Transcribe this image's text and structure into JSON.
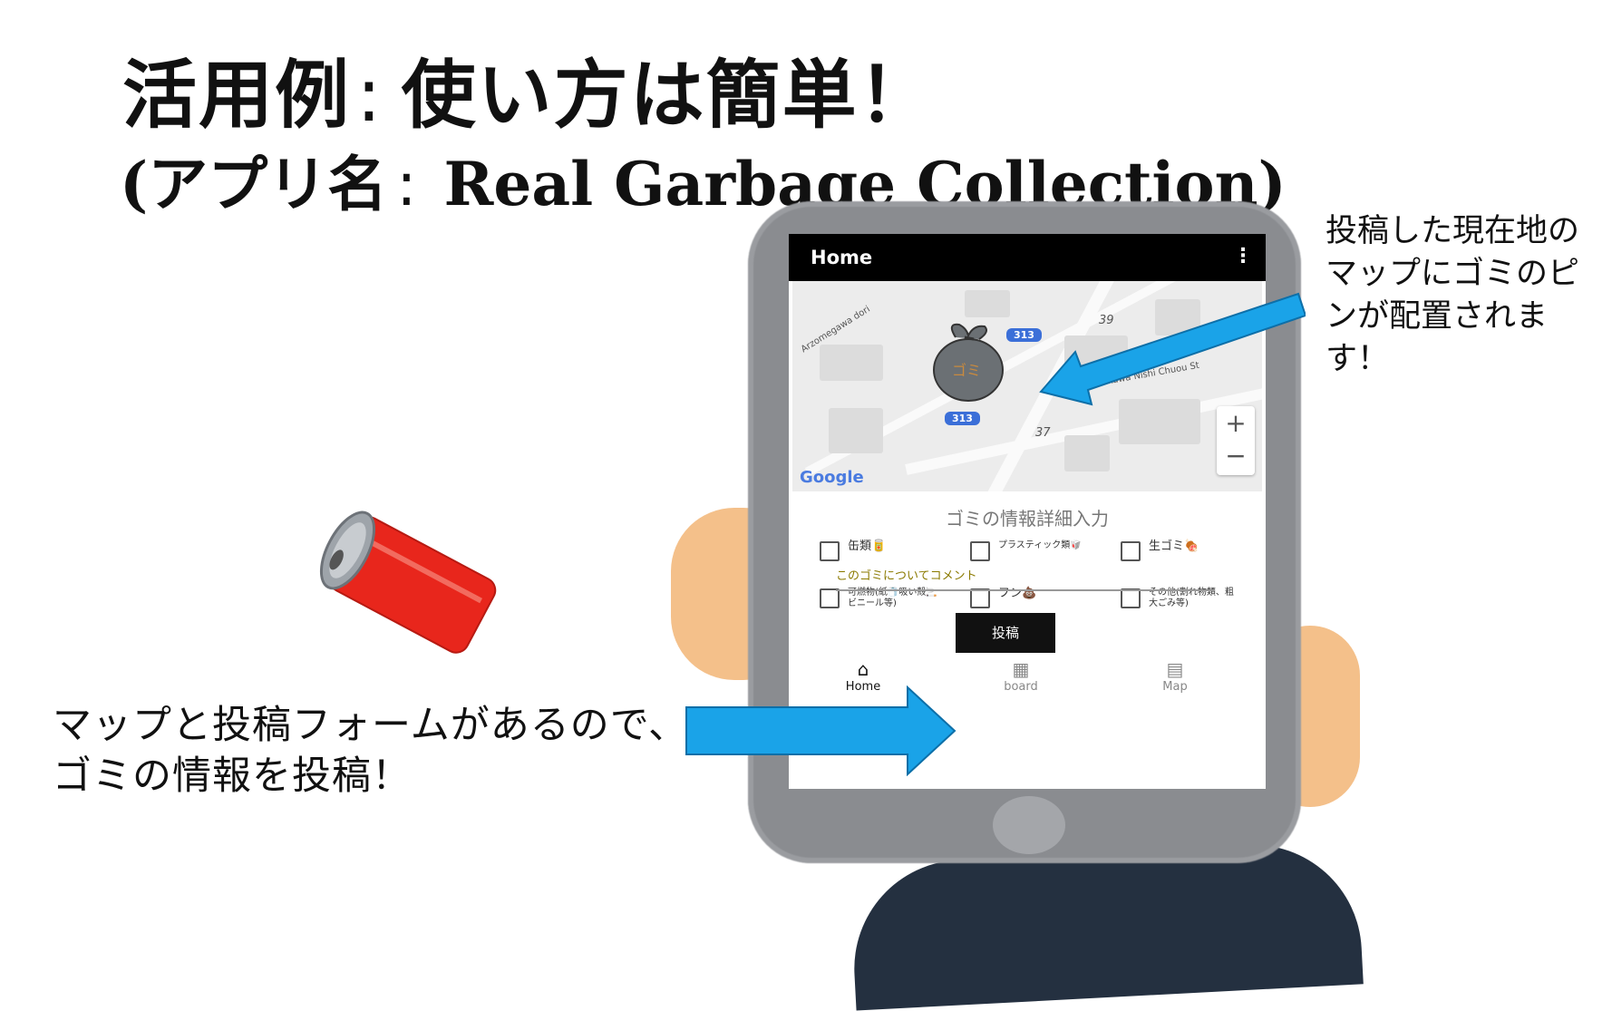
{
  "title": {
    "line1_label": "活用例",
    "line1_sep": ":",
    "line1_text": "使い方は簡単！",
    "line2_open": "(",
    "line2_label": "アプリ名",
    "line2_sep": ":",
    "line2_app": "Real Garbage Collection)"
  },
  "app": {
    "appbar_title": "Home",
    "appbar_menu_icon": "more-vert-icon",
    "map": {
      "road_labels": [
        "Arzomegawa dori",
        "Arakawa Nishi Chuou St"
      ],
      "route_shields": [
        "313",
        "313"
      ],
      "numbers": [
        "39",
        "37"
      ],
      "google_logo": "Google",
      "zoom_in": "+",
      "zoom_out": "−",
      "pin_text": "ゴミ"
    },
    "form": {
      "title": "ゴミの情報詳細入力",
      "checkboxes": [
        {
          "label": "缶類🥫",
          "checked": false
        },
        {
          "label": "プラスティック類🥡",
          "checked": false
        },
        {
          "label": "生ゴミ🍖",
          "checked": false
        },
        {
          "label": "可燃物(紙🧻吸い殻🚬ビニール等)",
          "checked": false
        },
        {
          "label": "フン💩",
          "checked": false
        },
        {
          "label": "その他(割れ物類、粗大ごみ等)",
          "checked": false
        }
      ],
      "comment_placeholder": "このゴミについてコメント",
      "submit_label": "投稿"
    },
    "nav": [
      {
        "label": "Home",
        "icon": "home-icon",
        "active": true
      },
      {
        "label": "board",
        "icon": "dashboard-icon",
        "active": false
      },
      {
        "label": "Map",
        "icon": "map-icon",
        "active": false
      }
    ]
  },
  "annotations": {
    "right": "投稿した現在地のマップにゴミのピンが配置されます！",
    "left": "マップと投稿フォームがあるので、ゴミの情報を投稿！"
  },
  "colors": {
    "arrow": "#1aa3e8",
    "can": "#e8261c",
    "skin": "#f4c08a",
    "tablet": "#8a8c90",
    "route_shield": "#3b6fd8"
  }
}
